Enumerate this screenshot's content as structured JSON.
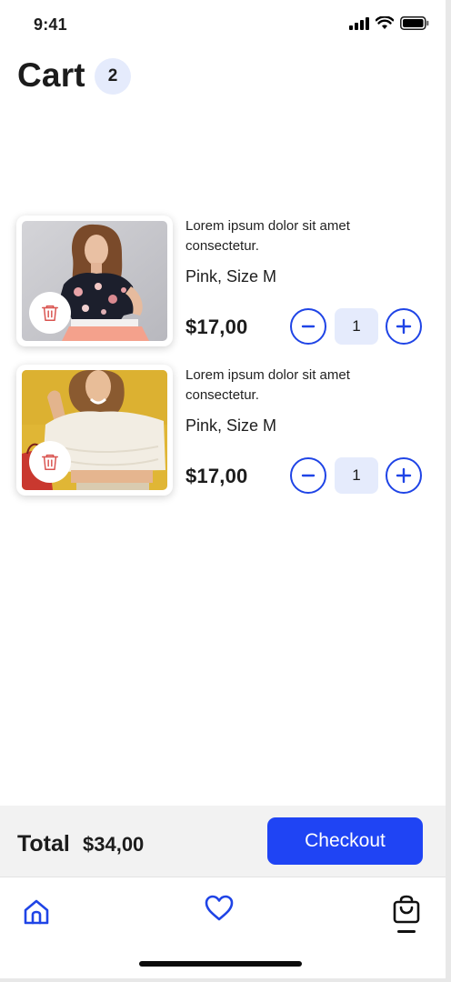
{
  "status_bar": {
    "time": "9:41",
    "icons": [
      "signal-icon",
      "wifi-icon",
      "battery-icon"
    ]
  },
  "header": {
    "title": "Cart",
    "count": "2"
  },
  "items": [
    {
      "description": "Lorem ipsum dolor sit amet consectetur.",
      "variant": "Pink, Size M",
      "price": "$17,00",
      "quantity": "1",
      "image": "woman in floral top and pink skirt"
    },
    {
      "description": "Lorem ipsum dolor sit amet consectetur.",
      "variant": "Pink, Size M",
      "price": "$17,00",
      "quantity": "1",
      "image": "woman in white off-shoulder top holding shopping bags"
    }
  ],
  "checkout": {
    "total_label": "Total",
    "total_value": "$34,00",
    "button_label": "Checkout"
  },
  "nav": {
    "items": [
      "home-icon",
      "heart-icon",
      "shopping-bag-icon"
    ],
    "active": "shopping-bag-icon"
  },
  "colors": {
    "accent": "#1f44f4",
    "badge_bg": "#e5ebfc",
    "delete": "#d9534f"
  }
}
